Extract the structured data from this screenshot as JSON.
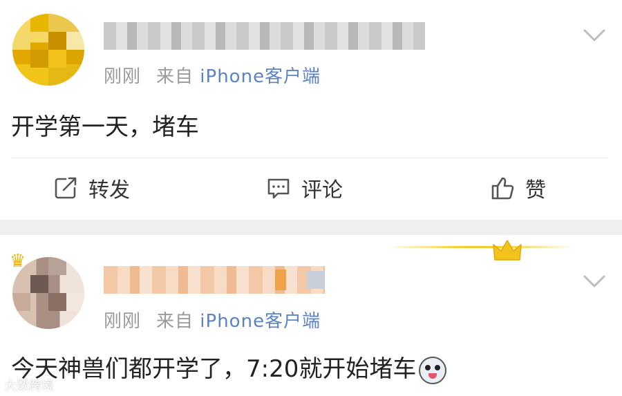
{
  "posts": [
    {
      "meta": {
        "time": "刚刚",
        "source_prefix": "来自",
        "source": "iPhone客户端"
      },
      "text": "开学第一天，堵车",
      "actions": {
        "repost": "转发",
        "comment": "评论",
        "like": "赞"
      }
    },
    {
      "meta": {
        "time": "刚刚",
        "source_prefix": "来自",
        "source": "iPhone客户端"
      },
      "text": "今天神兽们都开学了，7:20就开始堵车"
    }
  ],
  "watermark": "大数跨境",
  "colors": {
    "source_link": "#5b82c7",
    "meta": "#9a9a9a",
    "separator": "#efefef",
    "crown": "#f2b400"
  },
  "icons": [
    "chevron-down-icon",
    "repost-icon",
    "comment-icon",
    "like-icon",
    "crown-icon",
    "emoji-icon"
  ]
}
